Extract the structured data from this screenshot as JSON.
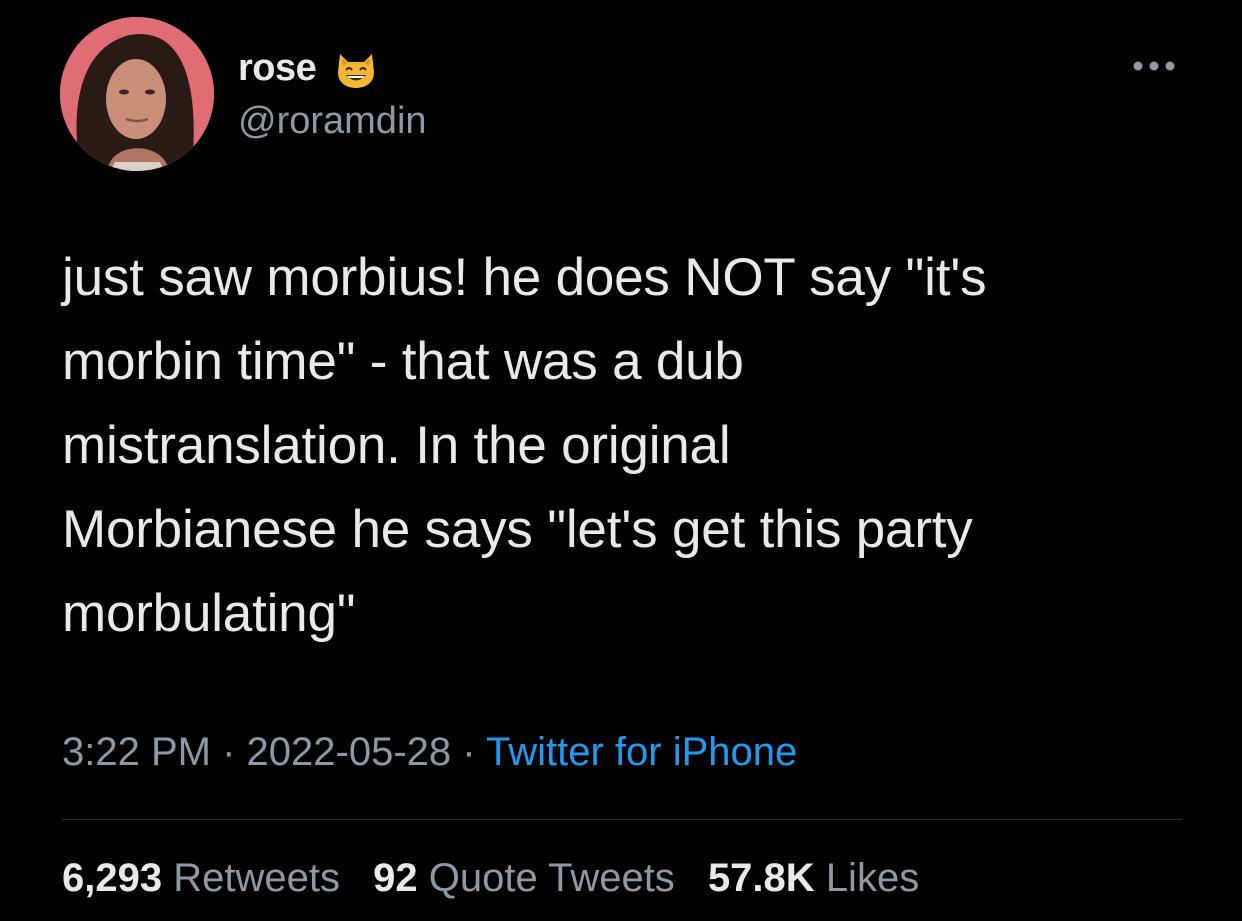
{
  "author": {
    "display_name": "rose",
    "display_name_emoji": "grinning-cat-emoji",
    "handle": "@roramdin",
    "avatar": "profile-photo"
  },
  "tweet": {
    "text_lines": [
      "just saw morbius! he does NOT say \"it's",
      "morbin time\" - that was a dub",
      "mistranslation. In the original",
      "Morbianese he says \"let's get this party",
      "morbulating\""
    ],
    "time": "3:22 PM",
    "separator": "·",
    "date": "2022-05-28",
    "source": "Twitter for iPhone"
  },
  "stats": {
    "retweets_count": "6,293",
    "retweets_label": "Retweets",
    "quote_count": "92",
    "quote_label": "Quote Tweets",
    "likes_count": "57.8K",
    "likes_label": "Likes"
  },
  "icons": {
    "more": "more-options-icon"
  },
  "colors": {
    "background": "#000000",
    "primary_text": "#e7e9ea",
    "secondary_text": "#8b98a5",
    "link": "#1d9bf0",
    "divider": "#2f3336"
  }
}
